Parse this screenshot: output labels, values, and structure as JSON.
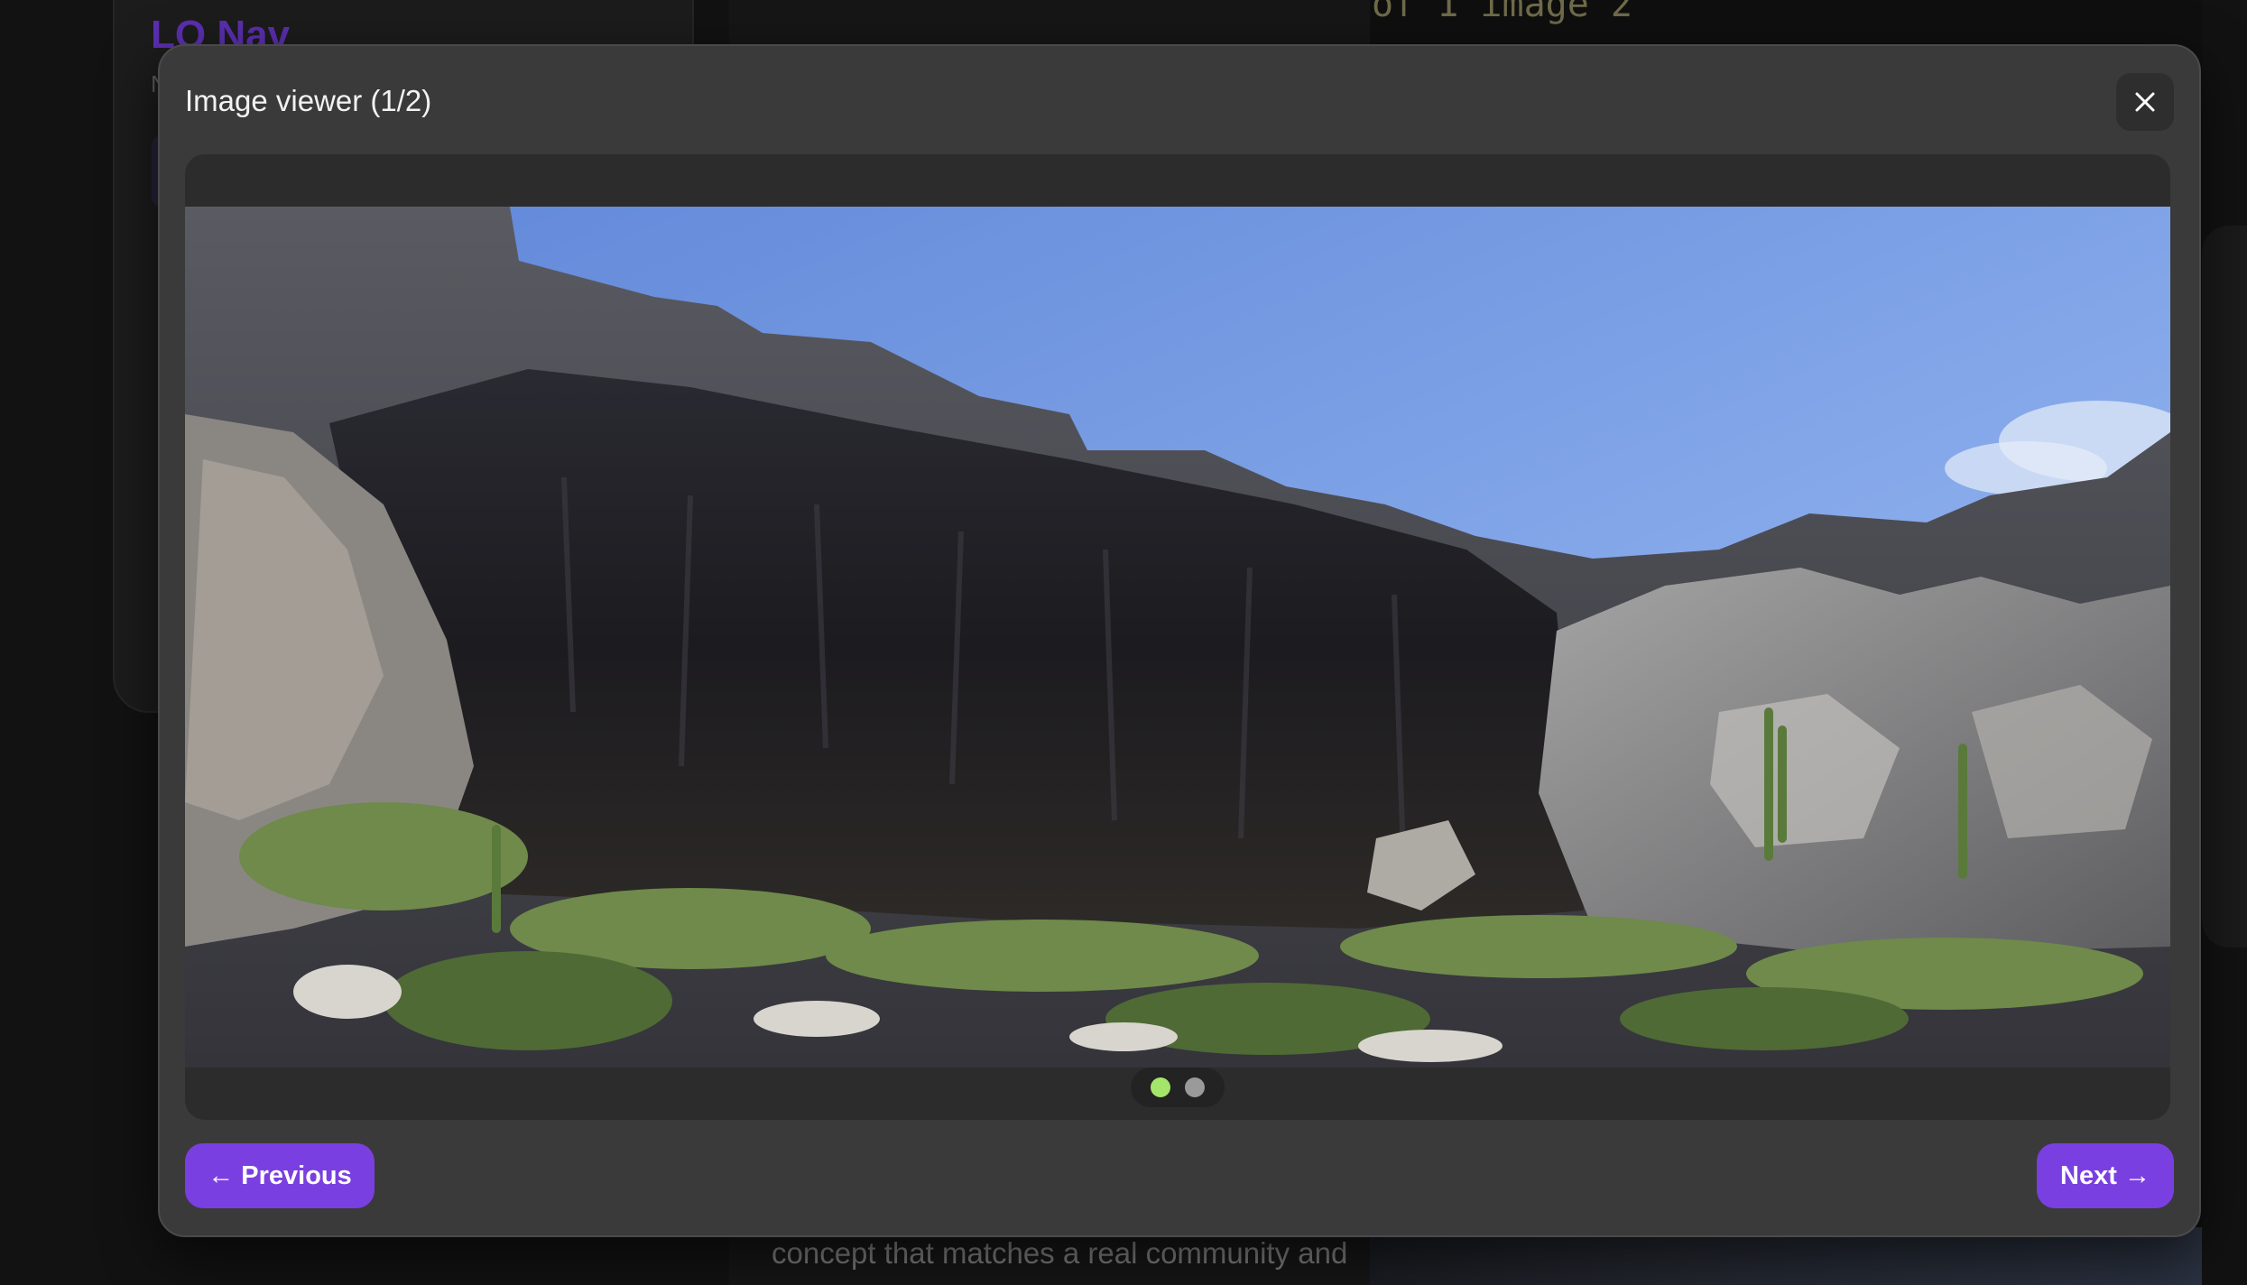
{
  "background": {
    "nav_title": "LO Nav",
    "nav_subtitle": "N",
    "middle_text": "concept that matches a real community and",
    "code_text": "of 1 image 2"
  },
  "modal": {
    "title": "Image viewer (1/2)",
    "close_icon": "close-icon",
    "image_alt": "Rocky limestone cliff cave with cacti and desert vegetation under blue sky",
    "current_index": 1,
    "total_images": 2,
    "dots": [
      {
        "state": "active",
        "color": "#a3e66a"
      },
      {
        "state": "inactive",
        "color": "#9a9a9a"
      }
    ],
    "prev_label": "← Previous",
    "next_label": "Next →"
  },
  "colors": {
    "accent": "#7a3fe0",
    "modal_bg": "#3a3a3a",
    "viewer_bg": "#2c2c2c",
    "active_dot": "#a3e66a"
  }
}
